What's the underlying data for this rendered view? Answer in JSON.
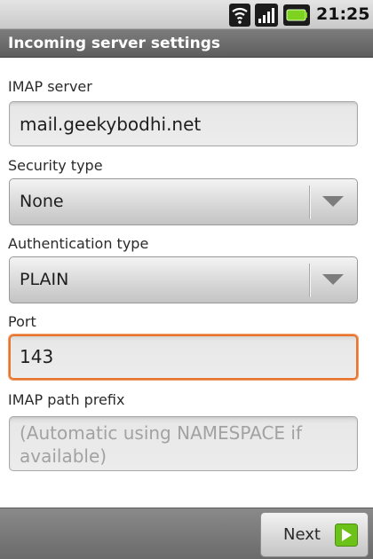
{
  "status_bar": {
    "time": "21:25",
    "icons": [
      "wifi-icon",
      "signal-icon",
      "battery-icon"
    ]
  },
  "header": {
    "title": "Incoming server settings"
  },
  "form": {
    "imap_server": {
      "label": "IMAP server",
      "value": "mail.geekybodhi.net"
    },
    "security_type": {
      "label": "Security type",
      "selected": "None"
    },
    "authentication_type": {
      "label": "Authentication type",
      "selected": "PLAIN"
    },
    "port": {
      "label": "Port",
      "value": "143"
    },
    "imap_path_prefix": {
      "label": "IMAP path prefix",
      "placeholder": "(Automatic using NAMESPACE if available)"
    }
  },
  "footer": {
    "next_label": "Next",
    "next_icon": "arrow-right-icon"
  },
  "colors": {
    "focus_border": "#e8742b",
    "next_icon_green": "#6cc219",
    "battery_green": "#7ed321"
  }
}
